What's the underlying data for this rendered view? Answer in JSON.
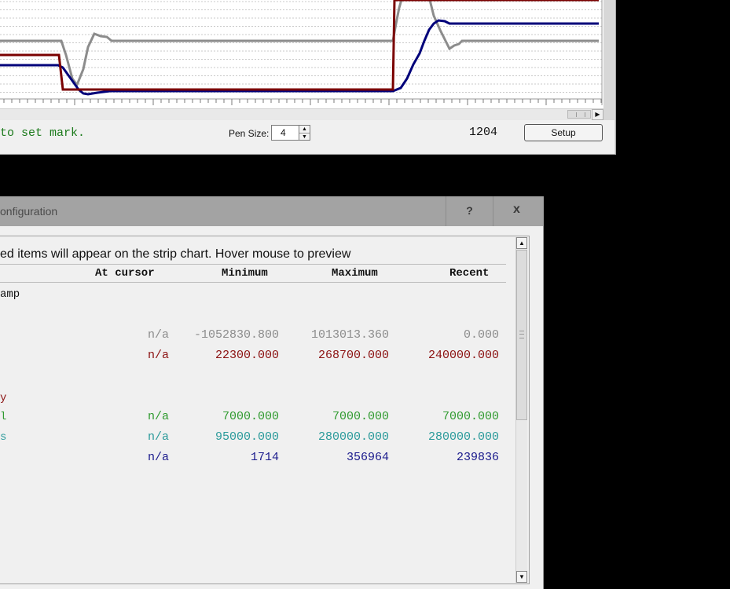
{
  "strip_chart": {
    "mark_hint": "to set mark.",
    "pen_size_label": "Pen Size:",
    "pen_size_value": "4",
    "counter": "1204",
    "setup_label": "Setup",
    "colors": {
      "gray": "#8c8c8c",
      "red": "#7a0000",
      "blue": "#00007a"
    }
  },
  "config_dialog": {
    "title": "onfiguration",
    "help_label": "?",
    "close_label": "x",
    "instruction": "ed items will appear on the strip chart.   Hover mouse to preview",
    "columns": {
      "at_cursor": "At cursor",
      "minimum": "Minimum",
      "maximum": "Maximum",
      "recent": "Recent"
    },
    "row_group_label": "amp",
    "rows": [
      {
        "label": "",
        "color": "#8c8c8c",
        "at_cursor": "n/a",
        "minimum": "-1052830.800",
        "maximum": "1013013.360",
        "recent": "0.000"
      },
      {
        "label": "",
        "color": "#8b1010",
        "at_cursor": "n/a",
        "minimum": "22300.000",
        "maximum": "268700.000",
        "recent": "240000.000"
      },
      {
        "label": "y",
        "color": "#8b1010"
      },
      {
        "label": "l",
        "color": "#2e9a2e",
        "at_cursor": "n/a",
        "minimum": "7000.000",
        "maximum": "7000.000",
        "recent": "7000.000"
      },
      {
        "label": "s",
        "color": "#2a9a9a",
        "at_cursor": "n/a",
        "minimum": "95000.000",
        "maximum": "280000.000",
        "recent": "280000.000"
      },
      {
        "label": "",
        "color": "#1a1a8c",
        "at_cursor": "n/a",
        "minimum": "1714",
        "maximum": "356964",
        "recent": "239836"
      }
    ]
  }
}
